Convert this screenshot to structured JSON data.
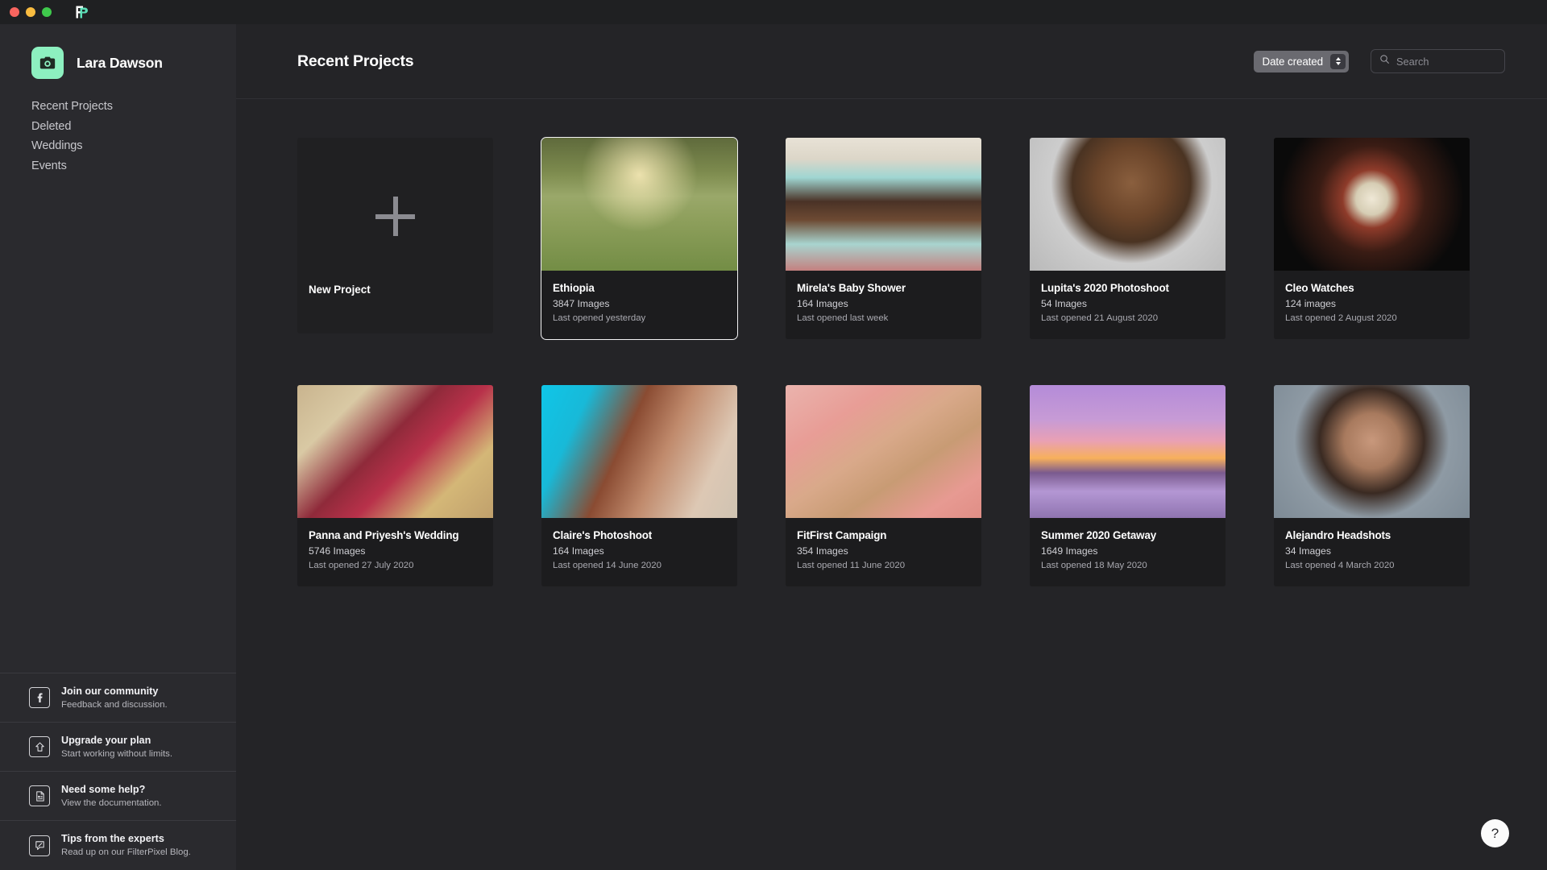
{
  "window": {
    "traffic_lights": [
      "close",
      "minimize",
      "maximize"
    ],
    "app_logo_name": "filterpixel-logo",
    "logo_accent": "#5ce0b8"
  },
  "sidebar": {
    "user": {
      "name": "Lara Dawson",
      "avatar_icon": "camera-icon",
      "avatar_color": "#8df0c0"
    },
    "nav_items": [
      {
        "label": "Recent Projects",
        "name": "recent-projects"
      },
      {
        "label": "Deleted",
        "name": "deleted"
      },
      {
        "label": "Weddings",
        "name": "weddings"
      },
      {
        "label": "Events",
        "name": "events"
      }
    ],
    "promos": [
      {
        "icon": "facebook-icon",
        "title": "Join our community",
        "subtitle": "Feedback and discussion."
      },
      {
        "icon": "upgrade-arrow-icon",
        "title": "Upgrade your plan",
        "subtitle": "Start working without limits."
      },
      {
        "icon": "document-icon",
        "title": "Need some help?",
        "subtitle": "View the documentation."
      },
      {
        "icon": "chat-pen-icon",
        "title": "Tips from the experts",
        "subtitle": "Read up on our FilterPixel Blog."
      }
    ]
  },
  "header": {
    "title": "Recent Projects",
    "sort": {
      "value": "Date created",
      "icon": "stepper-icon"
    },
    "search": {
      "placeholder": "Search",
      "value": "",
      "icon": "search-icon"
    }
  },
  "new_project": {
    "label": "New Project",
    "icon": "plus-icon"
  },
  "projects": [
    {
      "title": "Ethiopia",
      "count": "3847 Images",
      "opened": "Last opened yesterday",
      "thumb": "th-ethiopia",
      "selected": true
    },
    {
      "title": "Mirela's Baby Shower",
      "count": "164 Images",
      "opened": "Last opened last week",
      "thumb": "th-cake",
      "selected": false
    },
    {
      "title": "Lupita's 2020 Photoshoot",
      "count": "54 Images",
      "opened": "Last opened 21 August 2020",
      "thumb": "th-lupita",
      "selected": false
    },
    {
      "title": "Cleo Watches",
      "count": "124 images",
      "opened": "Last opened 2 August 2020",
      "thumb": "th-watch",
      "selected": false
    },
    {
      "title": "Panna and Priyesh's Wedding",
      "count": "5746 Images",
      "opened": "Last opened 27 July 2020",
      "thumb": "th-wedding",
      "selected": false
    },
    {
      "title": "Claire's Photoshoot",
      "count": "164 Images",
      "opened": "Last opened 14 June 2020",
      "thumb": "th-claire",
      "selected": false
    },
    {
      "title": "FitFirst Campaign",
      "count": "354 Images",
      "opened": "Last opened 11 June 2020",
      "thumb": "th-fitfirst",
      "selected": false
    },
    {
      "title": "Summer 2020 Getaway",
      "count": "1649 Images",
      "opened": "Last opened 18 May 2020",
      "thumb": "th-summer",
      "selected": false
    },
    {
      "title": "Alejandro Headshots",
      "count": "34 Images",
      "opened": "Last opened 4 March 2020",
      "thumb": "th-alejandro",
      "selected": false
    }
  ],
  "help_button": {
    "label": "?",
    "icon": "question-mark-icon"
  }
}
